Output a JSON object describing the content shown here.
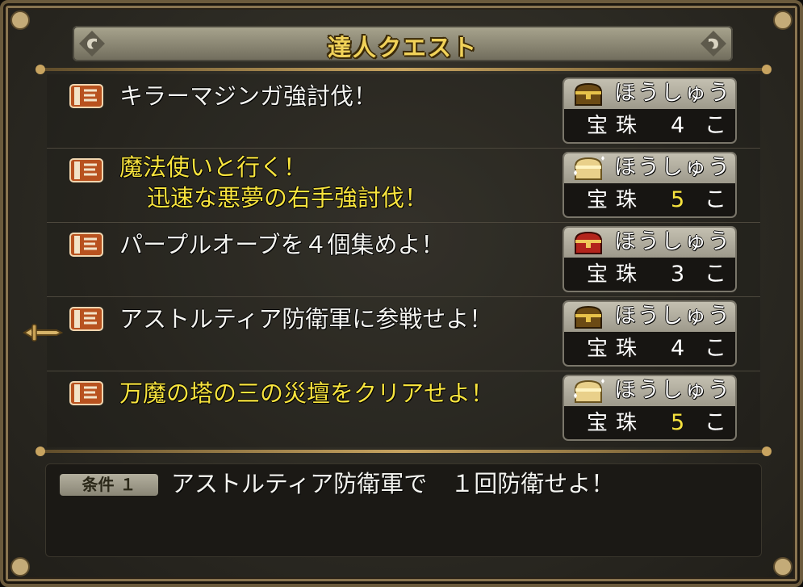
{
  "window": {
    "title": "達人クエスト"
  },
  "quests": [
    {
      "title_line1": "キラーマジンガ強討伐！",
      "title_line2": "",
      "highlight": false,
      "chest": "gold-chest",
      "reward_label": "ほうしゅう",
      "reward_item": "宝珠",
      "reward_count": "4",
      "reward_unit": "こ"
    },
    {
      "title_line1": "魔法使いと行く！",
      "title_line2": "迅速な悪夢の右手強討伐！",
      "highlight": true,
      "chest": "sparkle-chest",
      "reward_label": "ほうしゅう",
      "reward_item": "宝珠",
      "reward_count": "5",
      "reward_unit": "こ"
    },
    {
      "title_line1": "パープルオーブを４個集めよ！",
      "title_line2": "",
      "highlight": false,
      "chest": "red-chest",
      "reward_label": "ほうしゅう",
      "reward_item": "宝珠",
      "reward_count": "3",
      "reward_unit": "こ"
    },
    {
      "title_line1": "アストルティア防衛軍に参戦せよ！",
      "title_line2": "",
      "highlight": false,
      "chest": "gold-chest",
      "reward_label": "ほうしゅう",
      "reward_item": "宝珠",
      "reward_count": "4",
      "reward_unit": "こ"
    },
    {
      "title_line1": "万魔の塔の三の災壇をクリアせよ！",
      "title_line2": "",
      "highlight": true,
      "chest": "sparkle-chest",
      "reward_label": "ほうしゅう",
      "reward_item": "宝珠",
      "reward_count": "5",
      "reward_unit": "こ"
    }
  ],
  "detail": {
    "badge": "条件 １",
    "condition": "アストルティア防衛軍で　１回防衛せよ！"
  },
  "colors": {
    "highlight": "#f7e33e",
    "normal_text": "#f4f4f0",
    "title_gold": "#f1d259"
  }
}
